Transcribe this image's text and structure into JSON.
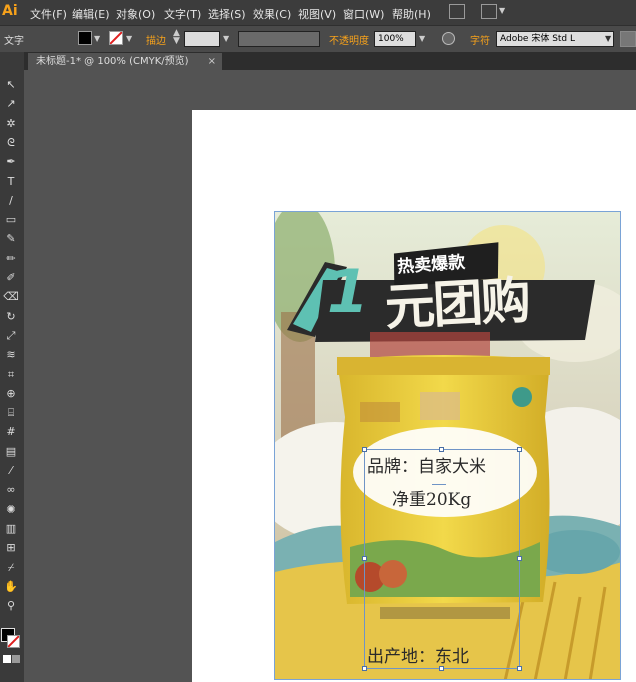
{
  "app": {
    "logo": "Ai"
  },
  "menu": [
    "文件(F)",
    "编辑(E)",
    "对象(O)",
    "文字(T)",
    "选择(S)",
    "效果(C)",
    "视图(V)",
    "窗口(W)",
    "帮助(H)"
  ],
  "control": {
    "label": "文字",
    "stroke_label": "描边",
    "opacity_label": "不透明度",
    "opacity_value": "100%",
    "char_label": "字符",
    "font_value": "Adobe 宋体 Std L"
  },
  "document_tab": {
    "title": "未标题-1* @ 100% (CMYK/预览)",
    "close": "×"
  },
  "poster": {
    "tag": "热卖爆款",
    "headline_digit": "1",
    "headline": "元团购",
    "brand": "品牌：自家大米",
    "weight": "净重20Kg",
    "origin": "出产地：东北"
  },
  "colors": {
    "accent": "#f7a21b",
    "selection": "#6f94c6",
    "bag": "#e8c93b"
  },
  "tools": [
    "selection-tool",
    "direct-selection-tool",
    "magic-wand-tool",
    "lasso-tool",
    "pen-tool",
    "type-tool",
    "line-tool",
    "rectangle-tool",
    "paintbrush-tool",
    "pencil-tool",
    "blob-brush-tool",
    "eraser-tool",
    "rotate-tool",
    "scale-tool",
    "warp-tool",
    "free-transform-tool",
    "shape-builder-tool",
    "perspective-grid-tool",
    "mesh-tool",
    "gradient-tool",
    "eyedropper-tool",
    "blend-tool",
    "symbol-sprayer-tool",
    "column-graph-tool",
    "artboard-tool",
    "slice-tool",
    "hand-tool",
    "zoom-tool"
  ],
  "tool_glyphs": [
    "↖",
    "↗",
    "✲",
    "ᘓ",
    "✒",
    "T",
    "/",
    "▭",
    "✎",
    "✏",
    "✐",
    "⌫",
    "↻",
    "⤢",
    "≋",
    "⌗",
    "⊕",
    "⌸",
    "#",
    "▤",
    "⁄",
    "∞",
    "✺",
    "▥",
    "⊞",
    "⌿",
    "✋",
    "⚲"
  ]
}
